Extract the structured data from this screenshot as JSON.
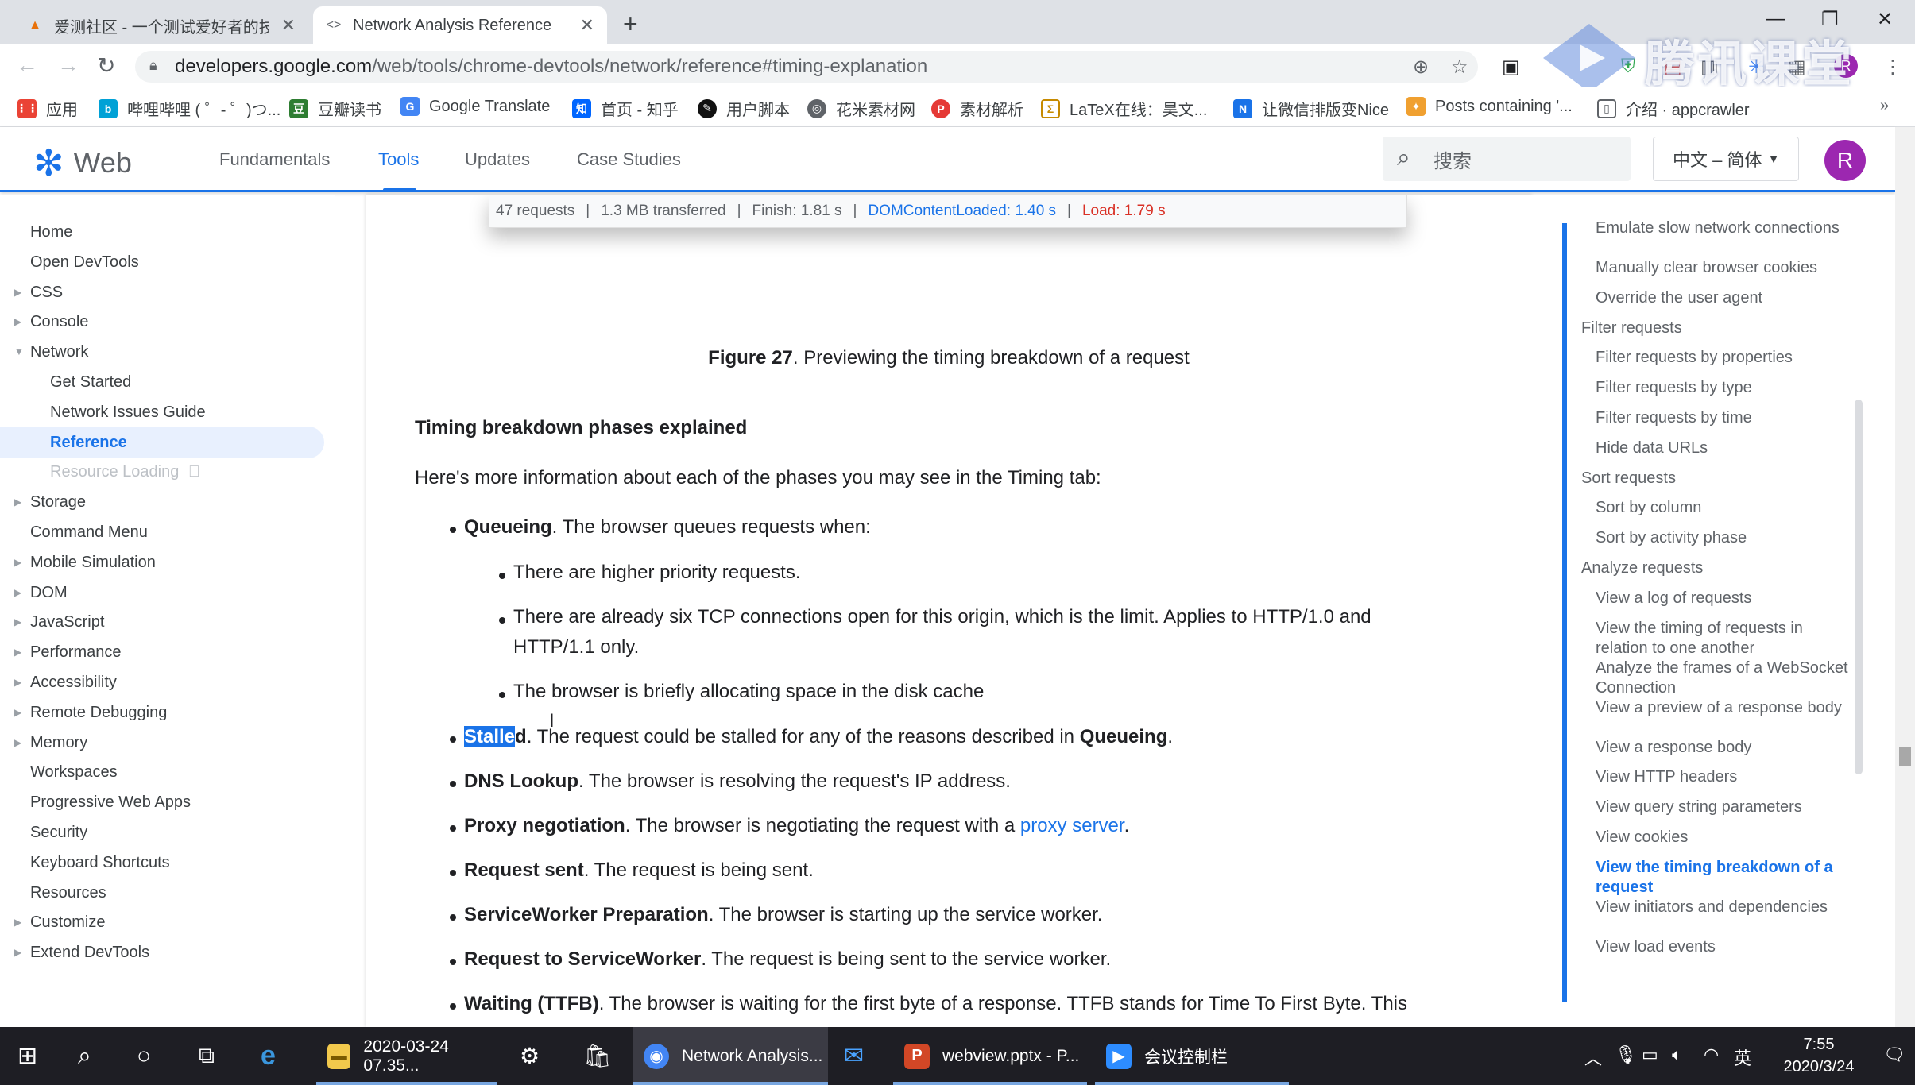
{
  "browser": {
    "tabs": [
      {
        "title": "爱测社区 - 一个测试爱好者的技",
        "active": false
      },
      {
        "title": "Network Analysis Reference",
        "active": true
      }
    ],
    "url_domain": "developers.google.com",
    "url_path": "/web/tools/chrome-devtools/network/reference#timing-explanation",
    "bookmarks": [
      {
        "label": "应用",
        "icon": "apps-grid-icon",
        "color": "#ea4335"
      },
      {
        "label": "哔哩哔哩 ( ゜- ゜)つ...",
        "icon": "bilibili-icon",
        "color": "#00a1d6"
      },
      {
        "label": "豆瓣读书",
        "icon": "douban-icon",
        "color": "#2e7d32"
      },
      {
        "label": "Google Translate",
        "icon": "translate-icon",
        "color": "#4285f4"
      },
      {
        "label": "首页 - 知乎",
        "icon": "zhihu-icon",
        "color": "#0066ff"
      },
      {
        "label": "用户脚本",
        "icon": "userscript-icon",
        "color": "#111111"
      },
      {
        "label": "花米素材网",
        "icon": "globe-icon",
        "color": "#5f6368"
      },
      {
        "label": "素材解析",
        "icon": "parse-icon",
        "color": "#e53935"
      },
      {
        "label": "LaTeX在线：昊文...",
        "icon": "latex-icon",
        "color": "#c68a00"
      },
      {
        "label": "让微信排版变Nice",
        "icon": "nice-icon",
        "color": "#1a73e8"
      },
      {
        "label": "Posts containing '...",
        "icon": "posts-icon",
        "color": "#f0a030"
      },
      {
        "label": "介绍 · appcrawler",
        "icon": "book-icon",
        "color": "#5f6368"
      }
    ],
    "watermark": "腾讯课堂"
  },
  "site": {
    "logo_text": "Web",
    "nav": [
      {
        "label": "Fundamentals",
        "active": false
      },
      {
        "label": "Tools",
        "active": true
      },
      {
        "label": "Updates",
        "active": false
      },
      {
        "label": "Case Studies",
        "active": false
      }
    ],
    "search_placeholder": "搜索",
    "language": "中文 – 简体",
    "avatar_letter": "R"
  },
  "leftnav": {
    "items": [
      {
        "label": "Home",
        "level": 0,
        "expandable": false,
        "state": "normal"
      },
      {
        "label": "Open DevTools",
        "level": 0,
        "expandable": false,
        "state": "normal"
      },
      {
        "label": "CSS",
        "level": 0,
        "expandable": true,
        "state": "normal"
      },
      {
        "label": "Console",
        "level": 0,
        "expandable": true,
        "state": "normal"
      },
      {
        "label": "Network",
        "level": 0,
        "expandable": true,
        "expanded": true,
        "state": "normal"
      },
      {
        "label": "Get Started",
        "level": 1,
        "expandable": false,
        "state": "normal"
      },
      {
        "label": "Network Issues Guide",
        "level": 1,
        "expandable": false,
        "state": "normal"
      },
      {
        "label": "Reference",
        "level": 1,
        "expandable": false,
        "state": "selected"
      },
      {
        "label": "Resource Loading",
        "level": 1,
        "expandable": false,
        "state": "disabled"
      },
      {
        "label": "Storage",
        "level": 0,
        "expandable": true,
        "state": "normal"
      },
      {
        "label": "Command Menu",
        "level": 0,
        "expandable": false,
        "state": "normal"
      },
      {
        "label": "Mobile Simulation",
        "level": 0,
        "expandable": true,
        "state": "normal"
      },
      {
        "label": "DOM",
        "level": 0,
        "expandable": true,
        "state": "normal"
      },
      {
        "label": "JavaScript",
        "level": 0,
        "expandable": true,
        "state": "normal"
      },
      {
        "label": "Performance",
        "level": 0,
        "expandable": true,
        "state": "normal"
      },
      {
        "label": "Accessibility",
        "level": 0,
        "expandable": true,
        "state": "normal"
      },
      {
        "label": "Remote Debugging",
        "level": 0,
        "expandable": true,
        "state": "normal"
      },
      {
        "label": "Memory",
        "level": 0,
        "expandable": true,
        "state": "normal"
      },
      {
        "label": "Workspaces",
        "level": 0,
        "expandable": false,
        "state": "normal"
      },
      {
        "label": "Progressive Web Apps",
        "level": 0,
        "expandable": false,
        "state": "normal"
      },
      {
        "label": "Security",
        "level": 0,
        "expandable": false,
        "state": "normal"
      },
      {
        "label": "Keyboard Shortcuts",
        "level": 0,
        "expandable": false,
        "state": "normal"
      },
      {
        "label": "Resources",
        "level": 0,
        "expandable": false,
        "state": "normal"
      },
      {
        "label": "Customize",
        "level": 0,
        "expandable": true,
        "state": "normal"
      },
      {
        "label": "Extend DevTools",
        "level": 0,
        "expandable": true,
        "state": "normal"
      }
    ]
  },
  "main": {
    "status_bar": {
      "requests": "47 requests",
      "transferred": "1.3 MB transferred",
      "finish": "Finish: 1.81 s",
      "dom_loaded": "DOMContentLoaded: 1.40 s",
      "load": "Load: 1.79 s"
    },
    "figure_label": "Figure 27",
    "figure_text": ". Previewing the timing breakdown of a request",
    "heading": "Timing breakdown phases explained",
    "intro": "Here's more information about each of the phases you may see in the Timing tab:",
    "queueing": {
      "term": "Queueing",
      "desc": ". The browser queues requests when:",
      "reasons": [
        "There are higher priority requests.",
        "There are already six TCP connections open for this origin, which is the limit. Applies to HTTP/1.0 and",
        "HTTP/1.1 only.",
        "The browser is briefly allocating space in the disk cache"
      ]
    },
    "stalled": {
      "term_selected": "Stalle",
      "term_rest": "d",
      "desc": ". The request could be stalled for any of the reasons described in ",
      "ref": "Queueing",
      "end": "."
    },
    "phases": [
      {
        "term": "DNS Lookup",
        "desc": ". The browser is resolving the request's IP address.",
        "link": "",
        "end": ""
      },
      {
        "term": "Proxy negotiation",
        "desc": ". The browser is negotiating the request with a ",
        "link": "proxy server",
        "end": "."
      },
      {
        "term": "Request sent",
        "desc": ". The request is being sent.",
        "link": "",
        "end": ""
      },
      {
        "term": "ServiceWorker Preparation",
        "desc": ". The browser is starting up the service worker.",
        "link": "",
        "end": ""
      },
      {
        "term": "Request to ServiceWorker",
        "desc": ". The request is being sent to the service worker.",
        "link": "",
        "end": ""
      },
      {
        "term": "Waiting (TTFB)",
        "desc": ". The browser is waiting for the first byte of a response. TTFB stands for Time To First Byte. This",
        "link": "",
        "end": ""
      }
    ]
  },
  "toc": {
    "items": [
      {
        "label": "Emulate slow network connections",
        "type": "sub",
        "active": false
      },
      {
        "label": "Manually clear browser cookies",
        "type": "sub",
        "active": false
      },
      {
        "label": "Override the user agent",
        "type": "sub",
        "active": false
      },
      {
        "label": "Filter requests",
        "type": "sec",
        "active": false
      },
      {
        "label": "Filter requests by properties",
        "type": "sub",
        "active": false
      },
      {
        "label": "Filter requests by type",
        "type": "sub",
        "active": false
      },
      {
        "label": "Filter requests by time",
        "type": "sub",
        "active": false
      },
      {
        "label": "Hide data URLs",
        "type": "sub",
        "active": false
      },
      {
        "label": "Sort requests",
        "type": "sec",
        "active": false
      },
      {
        "label": "Sort by column",
        "type": "sub",
        "active": false
      },
      {
        "label": "Sort by activity phase",
        "type": "sub",
        "active": false
      },
      {
        "label": "Analyze requests",
        "type": "sec",
        "active": false
      },
      {
        "label": "View a log of requests",
        "type": "sub",
        "active": false
      },
      {
        "label": "View the timing of requests in relation to one another",
        "type": "sub",
        "active": false
      },
      {
        "label": "Analyze the frames of a WebSocket Connection",
        "type": "sub",
        "active": false
      },
      {
        "label": "View a preview of a response body",
        "type": "sub",
        "active": false
      },
      {
        "label": "View a response body",
        "type": "sub",
        "active": false
      },
      {
        "label": "View HTTP headers",
        "type": "sub",
        "active": false
      },
      {
        "label": "View query string parameters",
        "type": "sub",
        "active": false
      },
      {
        "label": "View cookies",
        "type": "sub",
        "active": false
      },
      {
        "label": "View the timing breakdown of a request",
        "type": "sub",
        "active": true
      },
      {
        "label": "View initiators and dependencies",
        "type": "sub",
        "active": false
      },
      {
        "label": "View load events",
        "type": "sub",
        "active": false
      }
    ]
  },
  "taskbar": {
    "tasks": [
      {
        "label": "2020-03-24 07.35...",
        "icon": "folder-icon",
        "color": "#f2c94c",
        "active": false
      },
      {
        "label": "Network Analysis...",
        "icon": "chrome-icon",
        "color": "#4285f4",
        "active": true
      },
      {
        "label": "webview.pptx - P...",
        "icon": "powerpoint-icon",
        "color": "#d24726",
        "active": false
      },
      {
        "label": "会议控制栏",
        "icon": "meeting-icon",
        "color": "#2d8cff",
        "active": false
      }
    ],
    "ime": "英",
    "time": "7:55",
    "date": "2020/3/24"
  }
}
